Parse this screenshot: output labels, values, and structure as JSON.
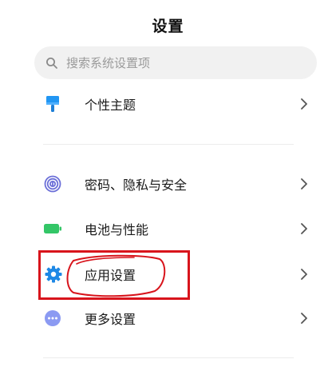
{
  "header": {
    "title": "设置"
  },
  "search": {
    "placeholder": "搜索系统设置项",
    "icon": "search-icon"
  },
  "items": [
    {
      "label": "个性主题",
      "icon": "brush-icon",
      "icon_color": "#2196f3"
    },
    {
      "label": "密码、隐私与安全",
      "icon": "fingerprint-icon",
      "icon_color": "#6b6fd8"
    },
    {
      "label": "电池与性能",
      "icon": "battery-icon",
      "icon_color": "#33c667"
    },
    {
      "label": "应用设置",
      "icon": "gear-icon",
      "icon_color": "#1e88e5"
    },
    {
      "label": "更多设置",
      "icon": "more-dots-icon",
      "icon_color": "#7c8ef0"
    }
  ],
  "annotation": {
    "color": "#d8141c"
  }
}
